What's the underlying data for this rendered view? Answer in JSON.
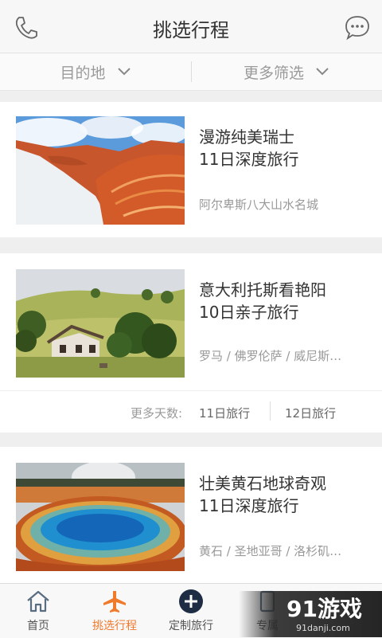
{
  "header": {
    "title": "挑选行程",
    "left_icon": "phone-icon",
    "right_icon": "chat-icon"
  },
  "filters": {
    "destination": "目的地",
    "more": "更多筛选"
  },
  "trips": [
    {
      "title_line1": "漫游纯美瑞士",
      "title_line2": "11日深度旅行",
      "places": "阿尔卑斯八大山水名城"
    },
    {
      "title_line1": "意大利托斯看艳阳",
      "title_line2": "10日亲子旅行",
      "places": "罗马 / 佛罗伦萨 / 威尼斯…"
    },
    {
      "title_line1": "壮美黄石地球奇观",
      "title_line2": "11日深度旅行",
      "places": "黄石 / 圣地亚哥 / 洛杉矶…"
    }
  ],
  "more_days": {
    "label": "更多天数:",
    "options": [
      "11日旅行",
      "12日旅行"
    ]
  },
  "tabs": [
    {
      "label": "首页",
      "icon": "home-icon"
    },
    {
      "label": "挑选行程",
      "icon": "plane-icon"
    },
    {
      "label": "定制旅行",
      "icon": "plus-circle-icon"
    },
    {
      "label": "专属",
      "icon": "card-icon"
    }
  ],
  "watermark": {
    "brand": "91游戏",
    "url": "91danji.com"
  },
  "colors": {
    "accent": "#f07a2c",
    "text": "#333333",
    "muted": "#999999"
  }
}
